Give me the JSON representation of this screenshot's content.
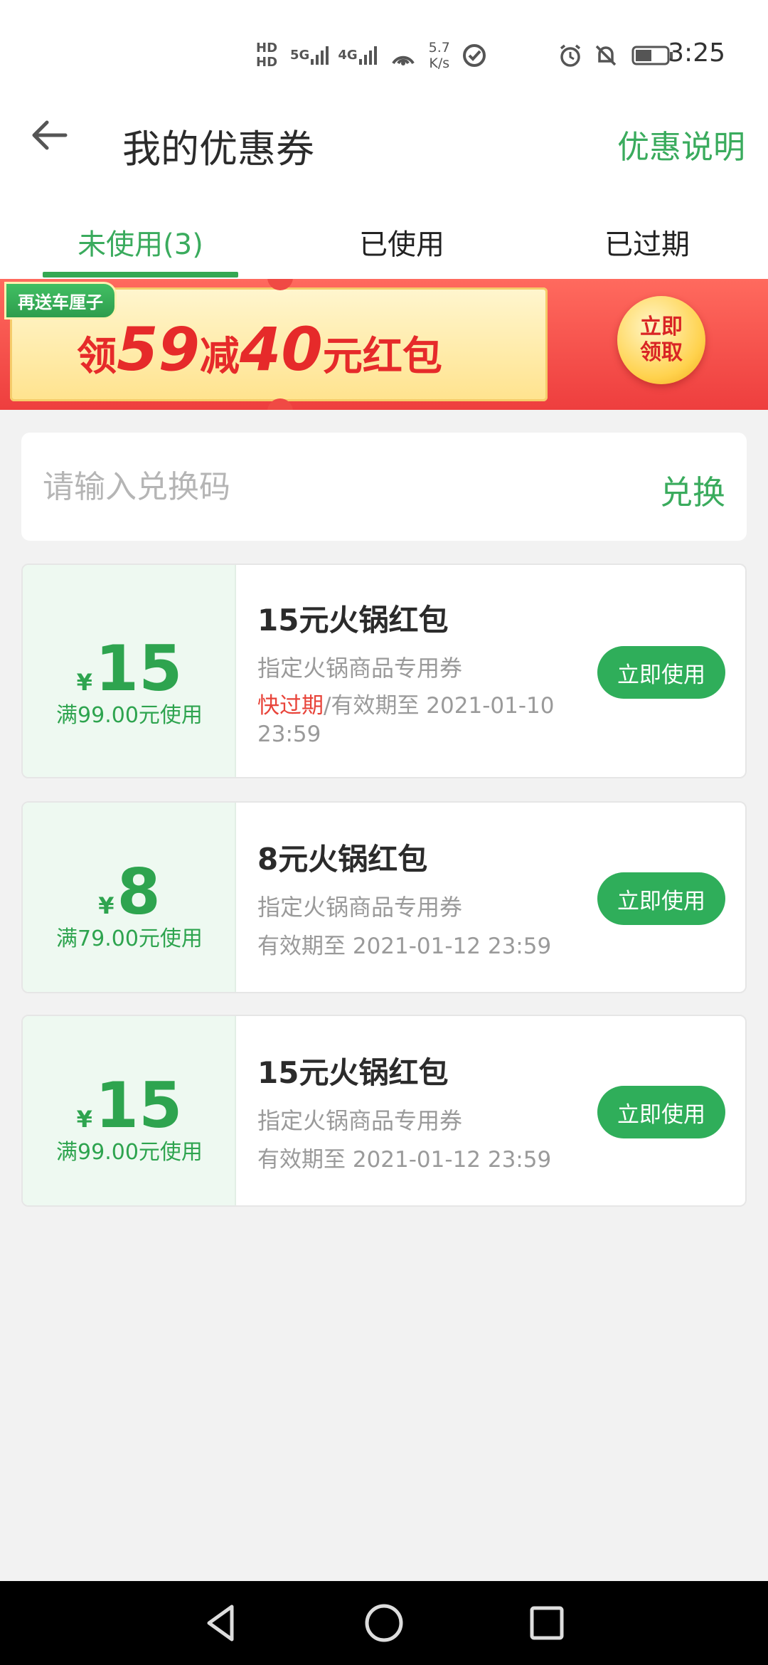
{
  "status_bar": {
    "hd1": "HD",
    "hd2": "HD",
    "net1": "5G",
    "net2": "4G",
    "speed_value": "5.7",
    "speed_unit": "K/s",
    "time": "3:25"
  },
  "header": {
    "title": "我的优惠券",
    "link": "优惠说明"
  },
  "tabs": [
    {
      "label": "未使用(3)",
      "active": true
    },
    {
      "label": "已使用",
      "active": false
    },
    {
      "label": "已过期",
      "active": false
    }
  ],
  "banner": {
    "tag": "再送车厘子",
    "text_1": "领",
    "amount_1": "59",
    "text_2": "减",
    "amount_2": "40",
    "text_3": "元红包",
    "cta_line1": "立即",
    "cta_line2": "领取"
  },
  "redeem": {
    "placeholder": "请输入兑换码",
    "button": "兑换"
  },
  "coupons": [
    {
      "currency": "¥",
      "amount": "15",
      "condition": "满99.00元使用",
      "title": "15元火锅红包",
      "desc": "指定火锅商品专用券",
      "warning": "快过期",
      "expiry": "/有效期至 2021-01-10 23:59",
      "button": "立即使用"
    },
    {
      "currency": "¥",
      "amount": "8",
      "condition": "满79.00元使用",
      "title": "8元火锅红包",
      "desc": "指定火锅商品专用券",
      "expiry": "有效期至 2021-01-12 23:59",
      "button": "立即使用"
    },
    {
      "currency": "¥",
      "amount": "15",
      "condition": "满99.00元使用",
      "title": "15元火锅红包",
      "desc": "指定火锅商品专用券",
      "expiry": "有效期至 2021-01-12 23:59",
      "button": "立即使用"
    }
  ],
  "colors": {
    "accent": "#3aab5d",
    "button": "#2fae5a",
    "warning": "#e8443a",
    "banner_red": "#ee3e3e"
  }
}
